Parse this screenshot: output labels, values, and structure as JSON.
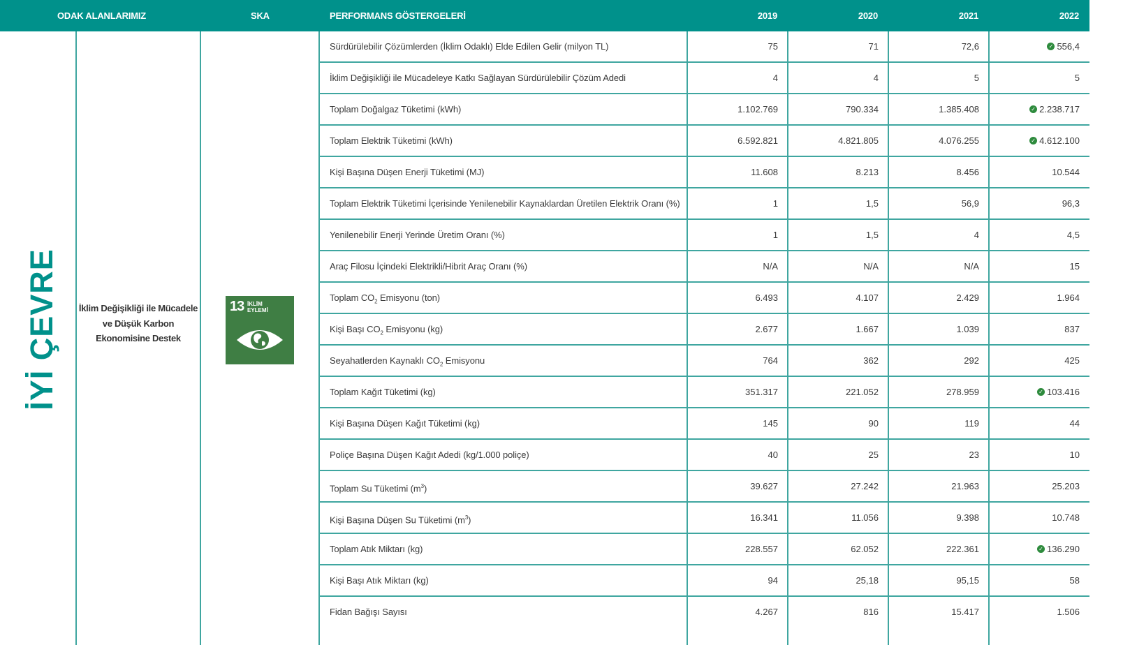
{
  "header": {
    "focus_areas": "ODAK ALANLARIMIZ",
    "ska": "SKA",
    "indicators": "PERFORMANS GÖSTERGELERİ",
    "years": [
      "2019",
      "2020",
      "2021",
      "2022"
    ]
  },
  "section_title": "İYİ ÇEVRE",
  "focus_area_text": "İklim Değişikliği ile Mücadele ve Düşük Karbon Ekonomisine Destek",
  "sdg": {
    "number": "13",
    "label_line1": "İKLİM",
    "label_line2": "EYLEMİ",
    "color": "#3f7e44",
    "icon": "eye-globe-icon"
  },
  "colors": {
    "accent": "#00918b",
    "grid": "#3fa6a0",
    "check": "#2e8b3d"
  },
  "rows": [
    {
      "label": "Sürdürülebilir Çözümlerden (İklim Odaklı) Elde Edilen Gelir (milyon TL)",
      "v2019": "75",
      "v2020": "71",
      "v2021": "72,6",
      "v2022": "556,4",
      "check": true
    },
    {
      "label": "İklim Değişikliği ile Mücadeleye Katkı Sağlayan Sürdürülebilir Çözüm Adedi",
      "v2019": "4",
      "v2020": "4",
      "v2021": "5",
      "v2022": "5",
      "check": false
    },
    {
      "label": "Toplam Doğalgaz Tüketimi (kWh)",
      "v2019": "1.102.769",
      "v2020": "790.334",
      "v2021": "1.385.408",
      "v2022": "2.238.717",
      "check": true
    },
    {
      "label": "Toplam Elektrik Tüketimi (kWh)",
      "v2019": "6.592.821",
      "v2020": "4.821.805",
      "v2021": "4.076.255",
      "v2022": "4.612.100",
      "check": true
    },
    {
      "label": "Kişi Başına Düşen Enerji Tüketimi (MJ)",
      "v2019": "11.608",
      "v2020": "8.213",
      "v2021": "8.456",
      "v2022": "10.544",
      "check": false
    },
    {
      "label": "Toplam Elektrik Tüketimi İçerisinde Yenilenebilir Kaynaklardan Üretilen Elektrik Oranı (%)",
      "v2019": "1",
      "v2020": "1,5",
      "v2021": "56,9",
      "v2022": "96,3",
      "check": false
    },
    {
      "label": "Yenilenebilir Enerji Yerinde Üretim Oranı (%)",
      "v2019": "1",
      "v2020": "1,5",
      "v2021": "4",
      "v2022": "4,5",
      "check": false
    },
    {
      "label": "Araç Filosu İçindeki Elektrikli/Hibrit Araç Oranı (%)",
      "v2019": "N/A",
      "v2020": "N/A",
      "v2021": "N/A",
      "v2022": "15",
      "check": false
    },
    {
      "label_pre": "Toplam CO",
      "label_sub": "2",
      "label_post": " Emisyonu (ton)",
      "v2019": "6.493",
      "v2020": "4.107",
      "v2021": "2.429",
      "v2022": "1.964",
      "check": false
    },
    {
      "label_pre": "Kişi Başı CO",
      "label_sub": "2",
      "label_post": " Emisyonu (kg)",
      "v2019": "2.677",
      "v2020": "1.667",
      "v2021": "1.039",
      "v2022": "837",
      "check": false
    },
    {
      "label_pre": "Seyahatlerden Kaynaklı CO",
      "label_sub": "2",
      "label_post": " Emisyonu",
      "v2019": "764",
      "v2020": "362",
      "v2021": "292",
      "v2022": "425",
      "check": false
    },
    {
      "label": "Toplam Kağıt Tüketimi (kg)",
      "v2019": "351.317",
      "v2020": "221.052",
      "v2021": "278.959",
      "v2022": "103.416",
      "check": true
    },
    {
      "label": "Kişi Başına Düşen Kağıt Tüketimi (kg)",
      "v2019": "145",
      "v2020": "90",
      "v2021": "119",
      "v2022": "44",
      "check": false
    },
    {
      "label": "Poliçe Başına Düşen Kağıt Adedi (kg/1.000 poliçe)",
      "v2019": "40",
      "v2020": "25",
      "v2021": "23",
      "v2022": "10",
      "check": false
    },
    {
      "label_pre": "Toplam Su Tüketimi (m",
      "label_sup": "3",
      "label_post": ")",
      "v2019": "39.627",
      "v2020": "27.242",
      "v2021": "21.963",
      "v2022": "25.203",
      "check": false
    },
    {
      "label_pre": "Kişi Başına Düşen Su Tüketimi (m",
      "label_sup": "3",
      "label_post": ")",
      "v2019": "16.341",
      "v2020": "11.056",
      "v2021": "9.398",
      "v2022": "10.748",
      "check": false
    },
    {
      "label": "Toplam Atık Miktarı (kg)",
      "v2019": "228.557",
      "v2020": "62.052",
      "v2021": "222.361",
      "v2022": "136.290",
      "check": true
    },
    {
      "label": "Kişi Başı Atık Miktarı (kg)",
      "v2019": "94",
      "v2020": "25,18",
      "v2021": "95,15",
      "v2022": "58",
      "check": false
    },
    {
      "label": "Fidan Bağışı Sayısı",
      "v2019": "4.267",
      "v2020": "816",
      "v2021": "15.417",
      "v2022": "1.506",
      "check": false
    }
  ]
}
